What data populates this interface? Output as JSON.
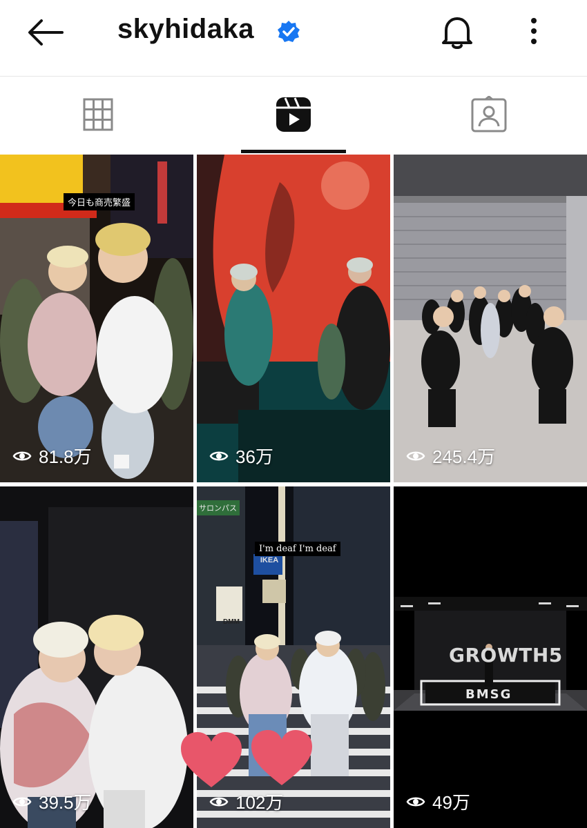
{
  "header": {
    "username": "skyhidaka",
    "back_icon": "arrow-left-icon",
    "verified_icon": "verified-badge-icon",
    "bell_icon": "bell-icon",
    "more_icon": "more-vertical-icon"
  },
  "tabs": [
    {
      "name": "grid",
      "icon": "grid-icon",
      "active": false
    },
    {
      "name": "reels",
      "icon": "reels-icon",
      "active": true
    },
    {
      "name": "tagged",
      "icon": "tagged-person-icon",
      "active": false
    }
  ],
  "reels": [
    {
      "views": "81.8万",
      "caption": "今日も商売繁盛"
    },
    {
      "views": "36万"
    },
    {
      "views": "245.4万"
    },
    {
      "views": "39.5万"
    },
    {
      "views": "102万",
      "caption": "I'm deaf I'm deaf",
      "signs": [
        "IKEA",
        "DMM",
        "サロンパス"
      ]
    },
    {
      "views": "49万",
      "sign_text": "GROWTH5",
      "floor_text": "BMSG"
    }
  ],
  "colors": {
    "accent": "#1877f2",
    "heart": "#e8566a"
  }
}
